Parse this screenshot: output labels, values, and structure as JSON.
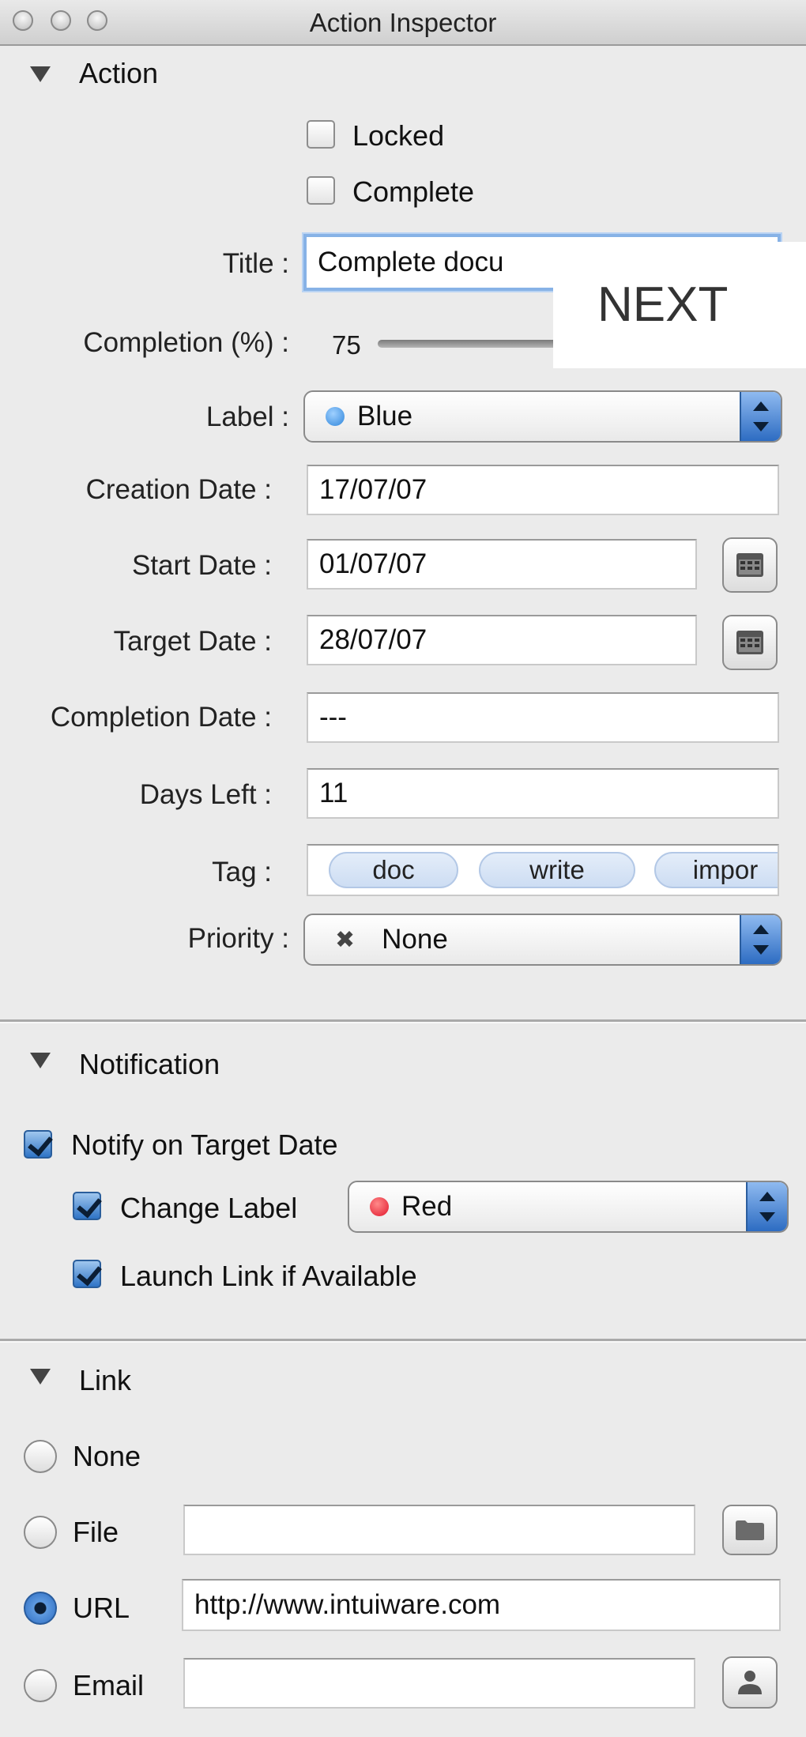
{
  "window": {
    "title": "Action Inspector"
  },
  "action": {
    "section_label": "Action",
    "locked_label": "Locked",
    "complete_label": "Complete",
    "title_label": "Title :",
    "title_value": "Complete docu",
    "completion_label": "Completion (%) :",
    "completion_value": "75",
    "completion_level": 0.75,
    "label_label": "Label :",
    "label_value": "Blue",
    "label_color": "#2f86db",
    "creation_date_label": "Creation Date :",
    "creation_date_value": "17/07/07",
    "start_date_label": "Start Date :",
    "start_date_value": "01/07/07",
    "target_date_label": "Target Date :",
    "target_date_value": "28/07/07",
    "completion_date_label": "Completion Date :",
    "completion_date_value": "---",
    "days_left_label": "Days Left :",
    "days_left_value": "11",
    "tag_label": "Tag :",
    "tags": [
      "doc",
      "write",
      "impor"
    ],
    "priority_label": "Priority :",
    "priority_icon": "x-icon",
    "priority_value": "None"
  },
  "overlay": {
    "next_label": "NEXT"
  },
  "notification": {
    "section_label": "Notification",
    "notify_label": "Notify on Target Date",
    "change_label_label": "Change Label",
    "change_label_value": "Red",
    "change_label_color": "#e2162b",
    "launch_link_label": "Launch Link if Available"
  },
  "link": {
    "section_label": "Link",
    "options": [
      "None",
      "File",
      "URL",
      "Email"
    ],
    "selected": "URL",
    "url_value": "http://www.intuiware.com",
    "file_value": "",
    "email_value": ""
  },
  "icons": {
    "calendar": "calendar-icon",
    "folder": "folder-icon",
    "person": "person-icon"
  },
  "colors": {
    "accent": "#2d6cc2",
    "focus_ring": "#87b2e6"
  }
}
